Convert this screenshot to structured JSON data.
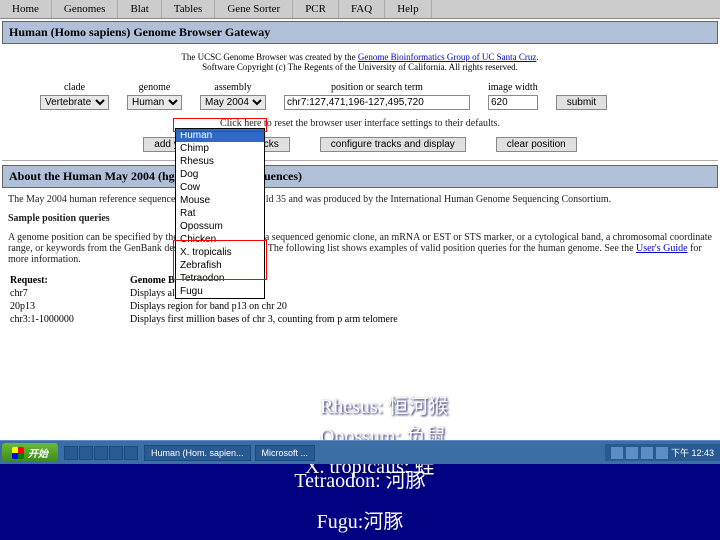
{
  "menubar": [
    "Home",
    "Genomes",
    "Blat",
    "Tables",
    "Gene Sorter",
    "PCR",
    "FAQ",
    "Help"
  ],
  "section1_title": "Human (Homo sapiens) Genome Browser Gateway",
  "credit_line1": "The UCSC Genome Browser was created by the ",
  "credit_link": "Genome Bioinformatics Group of UC Santa Cruz",
  "credit_line2": "Software Copyright (c) The Regents of the University of California. All rights reserved.",
  "form": {
    "labels": {
      "clade": "clade",
      "genome": "genome",
      "assembly": "assembly",
      "position": "position or search term",
      "width": "image width"
    },
    "clade": "Vertebrate",
    "genome": "Human",
    "assembly": "May 2004",
    "position": "chr7:127,471,196-127,495,720",
    "width": "620",
    "submit": "submit"
  },
  "hint": "Click here to reset the browser user interface settings to their defaults.",
  "btns": {
    "add": "add your own custom tracks",
    "config": "configure tracks and display",
    "clear": "clear position"
  },
  "section2_title": "About the Human May 2004 (hg17) assembly (sequences)",
  "about_p1a": "The May 2004 human reference sequence is based on NCBI Build 35 and was produced by the International Human Genome Sequencing Consortium.",
  "sample_hdr": "Sample position queries",
  "about_p2": "A genome position can be specified by the accession number of a sequenced genomic clone, an mRNA or EST or STS marker, or a cytological band, a chromosomal coordinate range, or keywords from the GenBank description of an mRNA. The following list shows examples of valid position queries for the human genome. See the ",
  "about_link": "User's Guide",
  "about_p2b": " for more information.",
  "examples": {
    "h1": "Request:",
    "h2": "Genome Browser Response:",
    "rows": [
      [
        "chr7",
        "Displays all of chromosome 7"
      ],
      [
        "20p13",
        "Displays region for band p13 on chr 20"
      ],
      [
        "chr3:1-1000000",
        "Displays first million bases of chr 3, counting from p arm telomere"
      ]
    ]
  },
  "dropdown_options": [
    "Human",
    "Chimp",
    "Rhesus",
    "Dog",
    "Cow",
    "Mouse",
    "Rat",
    "Opossum",
    "Chicken",
    "X. tropicalis",
    "Zebrafish",
    "Tetraodon",
    "Fugu"
  ],
  "taskbar": {
    "start": "开始",
    "tasks": [
      "Human (Hom. sapien...",
      "Microsoft ..."
    ],
    "clock": "下午 12:43"
  },
  "overlay": {
    "rhesus": "Rhesus: 恒河猴",
    "opossum": "Opossum: 负鼠",
    "xtrop": "X. tropicalis: 蛙"
  },
  "annotations": {
    "tetra": "Tetraodon: 河豚",
    "fugu": "Fugu:河豚"
  }
}
